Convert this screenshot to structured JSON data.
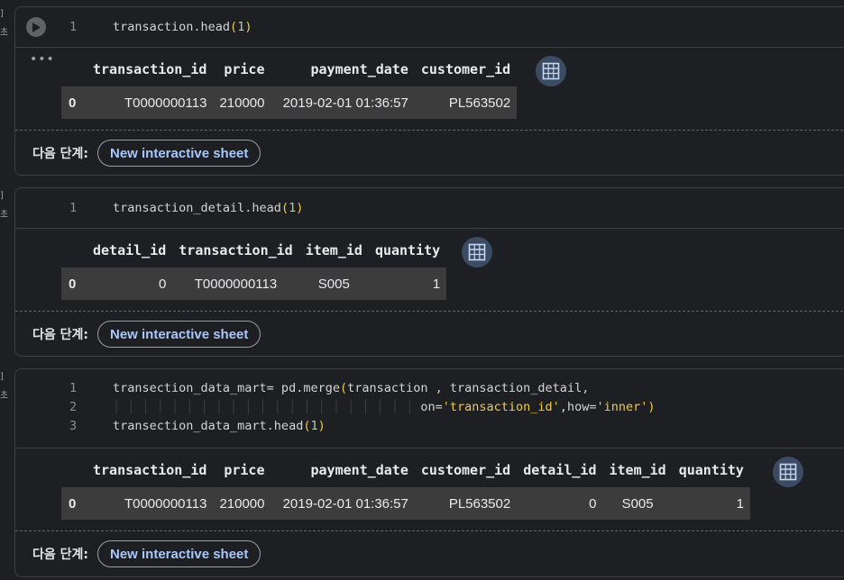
{
  "gutter": {
    "bracket": "]",
    "char": "초"
  },
  "cells": [
    {
      "code": [
        {
          "n": "1",
          "text": "transaction.head",
          "arg": "1"
        }
      ],
      "columns": [
        "transaction_id",
        "price",
        "payment_date",
        "customer_id"
      ],
      "row": {
        "index": "0",
        "values": [
          "T0000000113",
          "210000",
          "2019-02-01 01:36:57",
          "PL563502"
        ]
      }
    },
    {
      "code": [
        {
          "n": "1",
          "text": "transaction_detail.head",
          "arg": "1"
        }
      ],
      "columns": [
        "detail_id",
        "transaction_id",
        "item_id",
        "quantity"
      ],
      "row": {
        "index": "0",
        "values": [
          "0",
          "T0000000113",
          "S005",
          "1"
        ]
      }
    },
    {
      "code": [
        {
          "n": "1",
          "text": "transection_data_mart= pd.merge",
          "arg": "transaction , transaction_detail,"
        },
        {
          "n": "2",
          "prefix": "on=",
          "s1": "'transaction_id'",
          "mid": ",how=",
          "s2": "'inner'"
        },
        {
          "n": "3",
          "text": "transection_data_mart.head",
          "arg": "1"
        }
      ],
      "columns": [
        "transaction_id",
        "price",
        "payment_date",
        "customer_id",
        "detail_id",
        "item_id",
        "quantity"
      ],
      "row": {
        "index": "0",
        "values": [
          "T0000000113",
          "210000",
          "2019-02-01 01:36:57",
          "PL563502",
          "0",
          "S005",
          "1"
        ]
      }
    }
  ],
  "next_steps": {
    "label": "다음 단계:",
    "button": "New interactive sheet"
  },
  "colors": {
    "accent": "#a8c7fa",
    "icon_bg": "#3b4b64",
    "row_bg": "#3c3c3c"
  }
}
